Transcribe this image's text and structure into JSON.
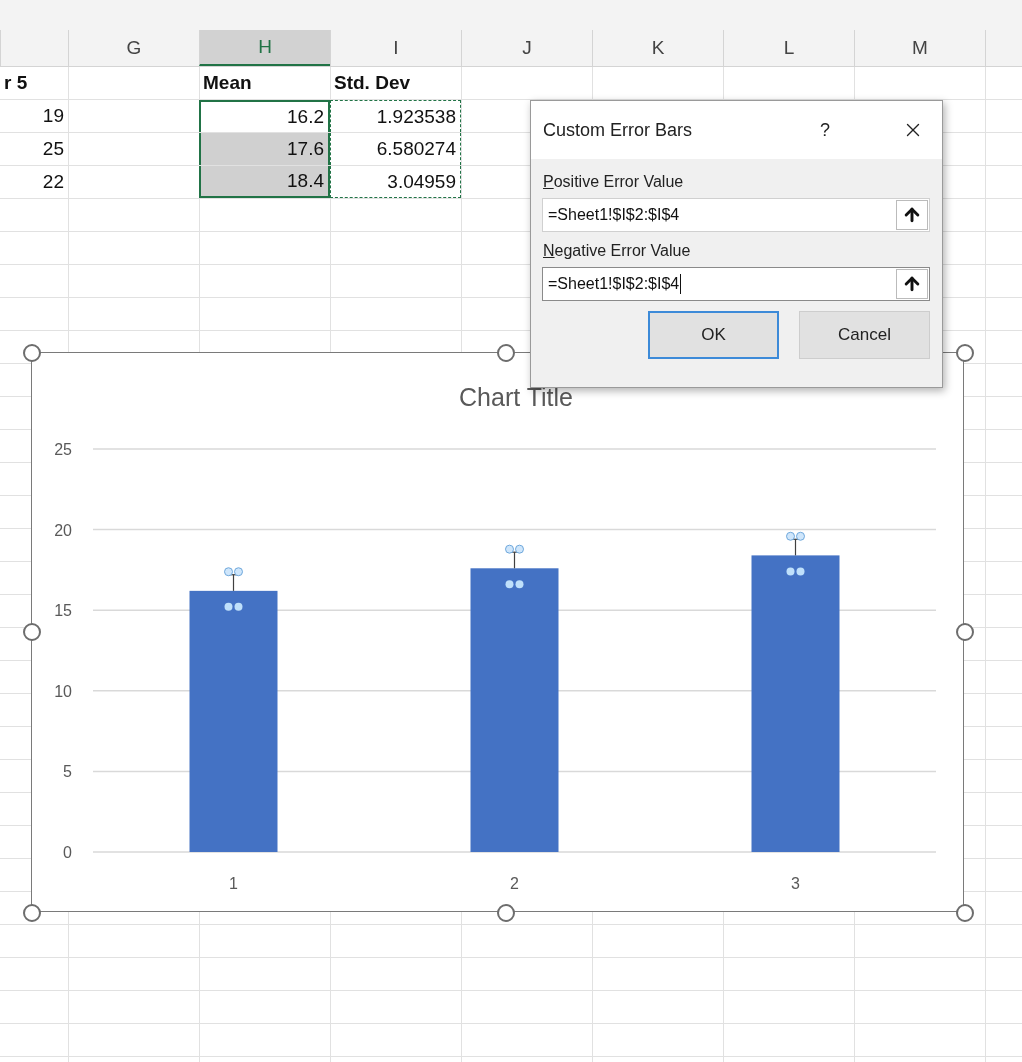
{
  "sheet": {
    "columns": [
      {
        "label": "G",
        "selected": false
      },
      {
        "label": "H",
        "selected": true
      },
      {
        "label": "I",
        "selected": false
      },
      {
        "label": "J",
        "selected": false
      },
      {
        "label": "K",
        "selected": false
      },
      {
        "label": "L",
        "selected": false
      },
      {
        "label": "M",
        "selected": false
      }
    ],
    "rows": [
      {
        "kind": "header",
        "f": {
          "text": "r 5"
        },
        "h": {
          "text": "Mean",
          "selected": false
        },
        "i": {
          "text": "Std. Dev",
          "copied": false
        }
      },
      {
        "kind": "data",
        "f": {
          "text": "19"
        },
        "h": {
          "text": "16.2",
          "selected": true,
          "active": true
        },
        "i": {
          "text": "1.923538",
          "copied": true
        }
      },
      {
        "kind": "data",
        "f": {
          "text": "25"
        },
        "h": {
          "text": "17.6",
          "selected": true,
          "active": false
        },
        "i": {
          "text": "6.580274",
          "copied": true
        }
      },
      {
        "kind": "data",
        "f": {
          "text": "22"
        },
        "h": {
          "text": "18.4",
          "selected": true,
          "active": false
        },
        "i": {
          "text": "3.04959",
          "copied": true
        }
      }
    ]
  },
  "chart": {
    "selected": true,
    "chart_data": {
      "type": "bar",
      "title": "Chart Title",
      "categories": [
        "1",
        "2",
        "3"
      ],
      "series": [
        {
          "color": "#4472c4",
          "values": [
            16.2,
            17.6,
            18.4
          ]
        }
      ],
      "ylim": [
        0,
        25
      ],
      "yticks": [
        0,
        5,
        10,
        15,
        20,
        25
      ],
      "grid": true
    }
  },
  "dialog": {
    "title": "Custom Error Bars",
    "help": "?",
    "fields": [
      {
        "label": "Positive Error Value",
        "value": "=Sheet1!$I$2:$I$4",
        "focused": false
      },
      {
        "label": "Negative Error Value",
        "value": "=Sheet1!$I$2:$I$4",
        "focused": true
      }
    ],
    "buttons": [
      {
        "label": "OK",
        "default": true
      },
      {
        "label": "Cancel",
        "default": false
      }
    ]
  }
}
